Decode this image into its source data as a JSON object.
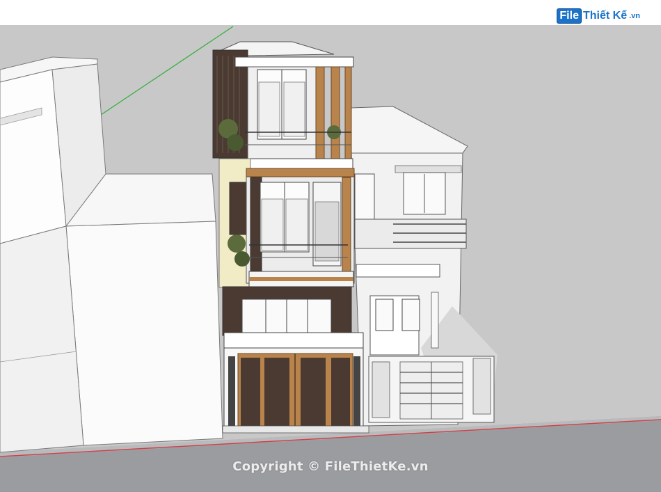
{
  "watermark": {
    "logo_box": "File",
    "logo_text": "Thiết Kế",
    "logo_tld": ".vn",
    "copyright": "Copyright © FileThietKe.vn"
  },
  "colors": {
    "sky": "#c9c9c9",
    "ground": "#9a9ca0",
    "wall_white": "#f4f4f4",
    "wood": "#b9834c",
    "stone": "#4a3a32",
    "accent_yellow": "#f1ecc5",
    "axis_green": "#2fae3a",
    "curb_red": "#c9444a",
    "logo_blue": "#1a73c8"
  }
}
